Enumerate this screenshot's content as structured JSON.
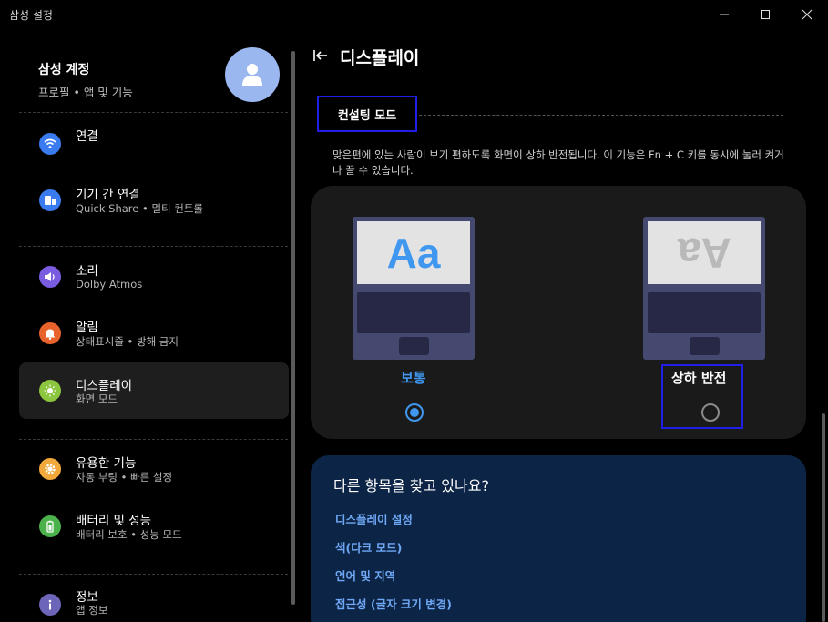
{
  "window": {
    "title": "삼성 설정"
  },
  "account": {
    "name": "삼성 계정",
    "subtitle": "프로필 • 앱 및 기능"
  },
  "sidebar": {
    "items": [
      {
        "label": "연결",
        "sub": "",
        "icon": "wifi-icon",
        "color": "#3a7cf0"
      },
      {
        "label": "기기 간 연결",
        "sub": "Quick Share  •  멀티 컨트롤",
        "icon": "devices-icon",
        "color": "#3a7cf0"
      },
      {
        "label": "소리",
        "sub": "Dolby Atmos",
        "icon": "speaker-icon",
        "color": "#7a5ce0"
      },
      {
        "label": "알림",
        "sub": "상태표시줄 • 방해 금지",
        "icon": "bell-icon",
        "color": "#e8632b"
      },
      {
        "label": "디스플레이",
        "sub": "화면 모드",
        "icon": "brightness-icon",
        "color": "#8cc63e"
      },
      {
        "label": "유용한 기능",
        "sub": "자동 부팅  •  빠른 설정",
        "icon": "gear-icon",
        "color": "#f2a93b"
      },
      {
        "label": "배터리 및 성능",
        "sub": "배터리 보호  •  성능 모드",
        "icon": "battery-icon",
        "color": "#4bb24b"
      },
      {
        "label": "정보",
        "sub": "앱 정보",
        "icon": "info-icon",
        "color": "#6d66b8"
      }
    ]
  },
  "main": {
    "title": "디스플레이",
    "section_title": "컨설팅 모드",
    "description": "맞은편에 있는 사람이 보기 편하도록 화면이 상하 반전됩니다. 이 기능은 Fn + C 키를 동시에 눌러 켜거나 끌 수 있습니다.",
    "preview_text": "Aa",
    "options": {
      "normal": {
        "label": "보통",
        "selected": true
      },
      "flip": {
        "label": "상하 반전",
        "selected": false
      }
    },
    "related": {
      "title": "다른 항목을 찾고 있나요?",
      "links": [
        "디스플레이 설정",
        "색(다크 모드)",
        "언어 및 지역",
        "접근성 (글자 크기 변경)"
      ]
    }
  },
  "colors": {
    "accent": "#3f97f0",
    "highlight_box": "#1f1fe6",
    "link": "#6fa8f5"
  }
}
